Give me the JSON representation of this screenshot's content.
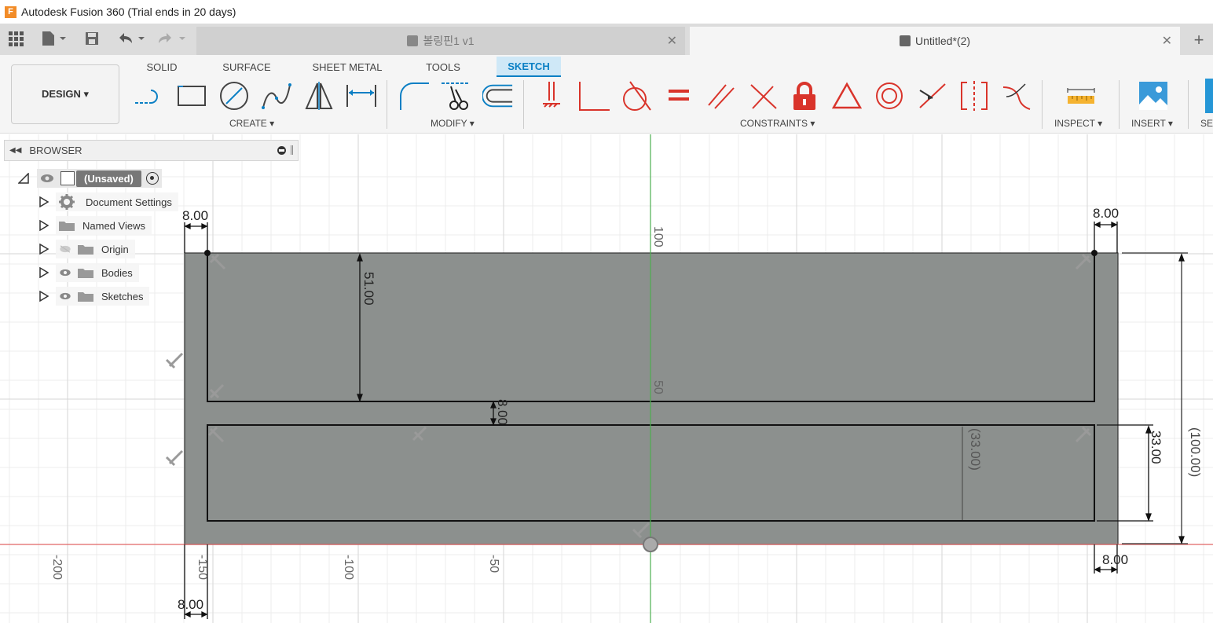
{
  "window": {
    "title": "Autodesk Fusion 360 (Trial ends in 20 days)",
    "logo_letter": "F"
  },
  "doc_tabs": [
    {
      "label": "볼링핀1 v1",
      "active": false
    },
    {
      "label": "Untitled*(2)",
      "active": true
    }
  ],
  "ribbon": {
    "workspace_button": "DESIGN ▾",
    "tabs": [
      "SOLID",
      "SURFACE",
      "SHEET METAL",
      "TOOLS",
      "SKETCH"
    ],
    "active_tab": "SKETCH",
    "groups": {
      "create": "CREATE ▾",
      "modify": "MODIFY ▾",
      "constraints": "CONSTRAINTS ▾",
      "inspect": "INSPECT ▾",
      "insert": "INSERT ▾",
      "select": "SE"
    },
    "icons": {
      "create": [
        "line-icon",
        "rectangle-icon",
        "circle-icon",
        "spline-icon",
        "mirror-icon",
        "dimension-icon"
      ],
      "modify": [
        "fillet-icon",
        "trim-icon",
        "offset-icon"
      ],
      "constraints": [
        "horizontal-vertical-icon",
        "coincident-icon",
        "tangent-icon",
        "equal-icon",
        "parallel-icon",
        "perpendicular-icon",
        "fix-unfix-icon",
        "midpoint-icon",
        "concentric-icon",
        "collinear-icon",
        "symmetry-icon",
        "curvature-icon"
      ],
      "inspect": [
        "measure-icon"
      ],
      "insert": [
        "insert-image-icon"
      ]
    },
    "accent_color": "#0a7fc4",
    "constraint_color": "#d9342b"
  },
  "browser": {
    "title": "BROWSER",
    "root_label": "(Unsaved)",
    "items": [
      {
        "label": "Document Settings",
        "icon": "gear-icon",
        "visible_toggle": false
      },
      {
        "label": "Named Views",
        "icon": "folder-icon",
        "visible_toggle": false
      },
      {
        "label": "Origin",
        "icon": "folder-icon",
        "visible_toggle": true,
        "hidden": true
      },
      {
        "label": "Bodies",
        "icon": "folder-icon",
        "visible_toggle": true,
        "hidden": false
      },
      {
        "label": "Sketches",
        "icon": "folder-icon",
        "visible_toggle": true,
        "hidden": false
      }
    ]
  },
  "sketch": {
    "axis_labels": [
      "100",
      "50",
      "-200",
      "-150",
      "-100",
      "-50"
    ],
    "dimensions": [
      "8.00",
      "8.00",
      "51.00",
      "8.00",
      "(33.00)",
      "33.00",
      "(100.00)",
      "8.00",
      "8.00"
    ],
    "profile_fill": "#8c908e",
    "axis_x_color": "#e06666",
    "axis_y_color": "#4caf50"
  }
}
